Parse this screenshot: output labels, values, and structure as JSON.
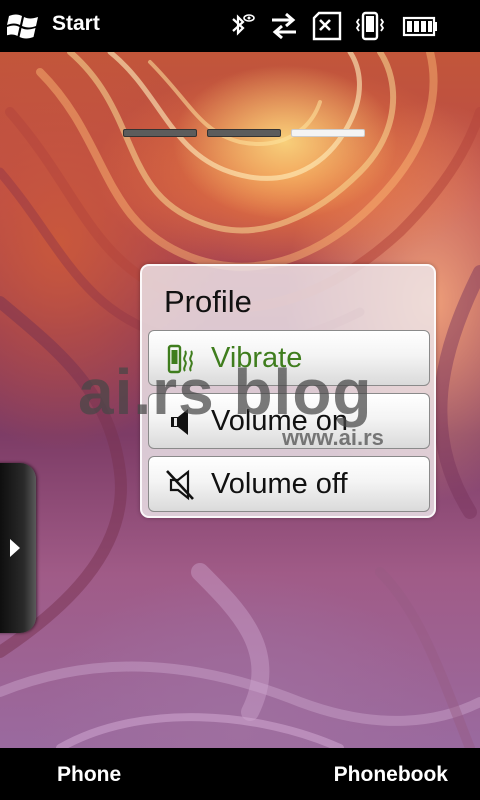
{
  "status_bar": {
    "start_label": "Start",
    "icons": [
      "bluetooth-icon",
      "data-connection-icon",
      "no-sim-icon",
      "vibrate-icon",
      "battery-icon"
    ]
  },
  "home": {
    "page_indicator": {
      "pages": 3,
      "active_page": 3
    }
  },
  "profile_menu": {
    "title": "Profile",
    "options": [
      {
        "label": "Vibrate",
        "icon": "vibrate-icon",
        "selected": true
      },
      {
        "label": "Volume on",
        "icon": "speaker-icon",
        "selected": false
      },
      {
        "label": "Volume off",
        "icon": "speaker-muted-icon",
        "selected": false
      }
    ],
    "accent_color": "#3f7d1d"
  },
  "watermark": {
    "main": "ai.rs blog",
    "url": "www.ai.rs"
  },
  "softkeys": {
    "left": "Phone",
    "right": "Phonebook"
  }
}
